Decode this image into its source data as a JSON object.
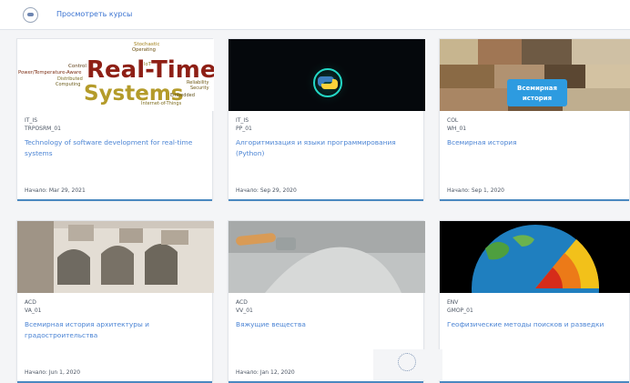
{
  "header": {
    "nav_link": "Просмотреть курсы"
  },
  "courses": [
    {
      "org": "IT_IS",
      "code": "TRPOSRM_01",
      "title": "Technology of software development for real-time systems",
      "start": "Начало: Mar 29, 2021",
      "image_words": {
        "w1": "Stochastic",
        "w2": "Operating",
        "w3": "Control",
        "w4": "IoT",
        "w5": "Power/Temperature-Aware",
        "w6": "Distributed",
        "w7": "Computing",
        "w8": "Real-Time",
        "w9": "Reliability",
        "w10": "Security",
        "w11": "Systems",
        "w12": "Embedded",
        "w13": "Internet-of-Things"
      }
    },
    {
      "org": "IT_IS",
      "code": "PP_01",
      "title": "Алгоритмизация и языки программирования (Python)",
      "start": "Начало: Sep 29, 2020"
    },
    {
      "org": "COL",
      "code": "WH_01",
      "title": "Всемирная история",
      "start": "Начало: Sep 1, 2020",
      "image_words": {
        "line1": "Всемирная",
        "line2": "история"
      }
    },
    {
      "org": "ACD",
      "code": "VA_01",
      "title": "Всемирная история архитектуры и градостроительства",
      "start": "Начало: Jun 1, 2020"
    },
    {
      "org": "ACD",
      "code": "VV_01",
      "title": "Вяжущие вещества",
      "start": "Начало: Jan 12, 2020"
    },
    {
      "org": "ENV",
      "code": "GMOP_01",
      "title": "Геофизические методы поисков и разведки"
    }
  ],
  "colors": {
    "link": "#4b84d4",
    "nav": "#3a73d1",
    "accent": "#4a88c0"
  }
}
